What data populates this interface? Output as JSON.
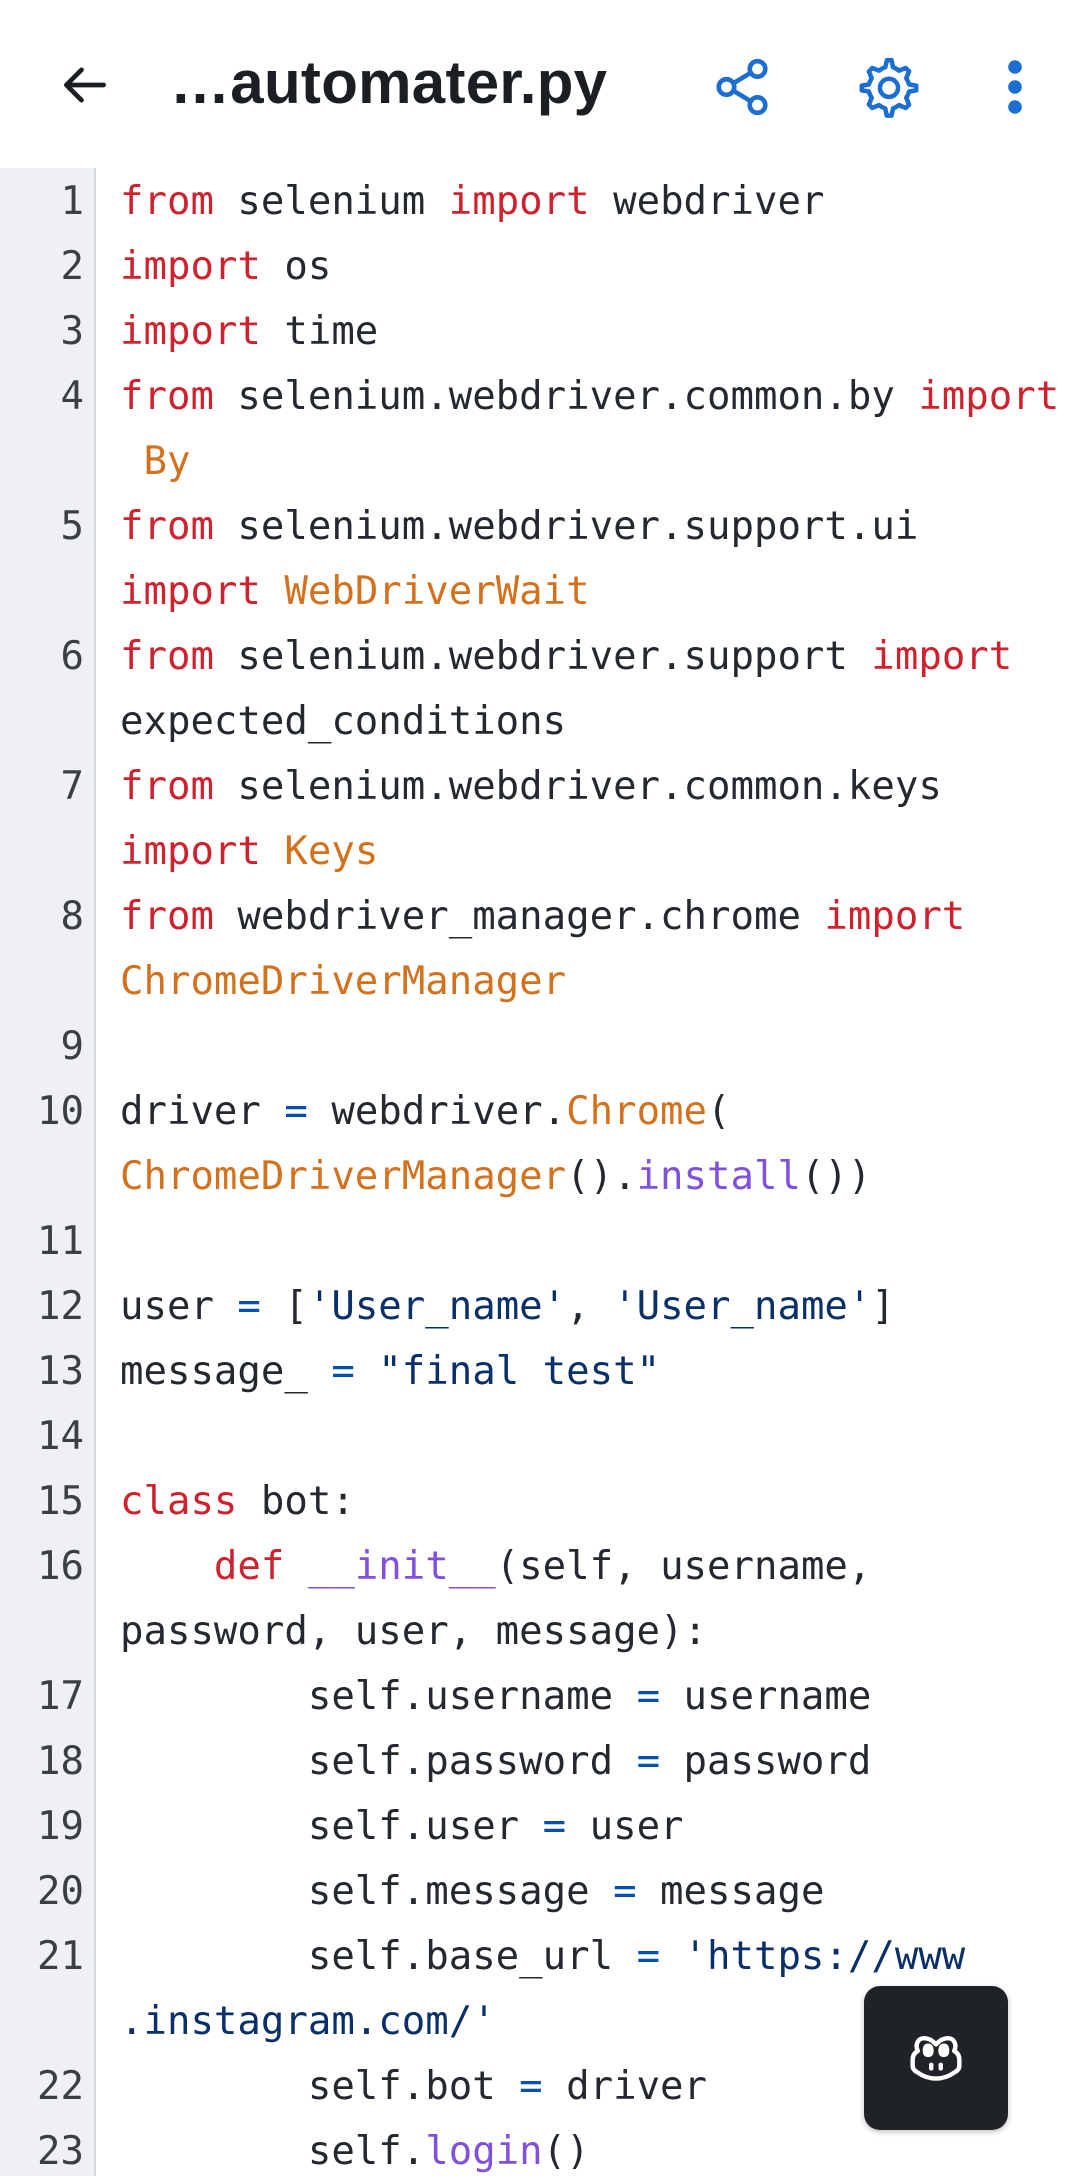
{
  "app": {
    "title": "…automater.py"
  },
  "header": {
    "back_icon": "arrow-left-icon",
    "share_icon": "share-icon",
    "settings_icon": "gear-icon",
    "more_icon": "kebab-menu-icon"
  },
  "colors": {
    "keyword": "#cf222e",
    "class_name": "#d3711c",
    "function": "#8250df",
    "string": "#0a3069",
    "operator": "#0550ae",
    "default": "#24292f",
    "icon_blue": "#1c6fd1"
  },
  "code": {
    "lines": [
      {
        "n": "1",
        "rows": [
          [
            [
              "kw",
              "from"
            ],
            [
              "tx",
              " selenium "
            ],
            [
              "kw",
              "import"
            ],
            [
              "tx",
              " webdriver"
            ]
          ]
        ]
      },
      {
        "n": "2",
        "rows": [
          [
            [
              "kw",
              "import"
            ],
            [
              "tx",
              " os"
            ]
          ]
        ]
      },
      {
        "n": "3",
        "rows": [
          [
            [
              "kw",
              "import"
            ],
            [
              "tx",
              " time"
            ]
          ]
        ]
      },
      {
        "n": "4",
        "rows": [
          [
            [
              "kw",
              "from"
            ],
            [
              "tx",
              " selenium.webdriver.common.by "
            ],
            [
              "kw",
              "import"
            ]
          ],
          [
            [
              "tx",
              " "
            ],
            [
              "cl",
              "By"
            ]
          ]
        ]
      },
      {
        "n": "5",
        "rows": [
          [
            [
              "kw",
              "from"
            ],
            [
              "tx",
              " selenium.webdriver.support.ui"
            ]
          ],
          [
            [
              "kw",
              "import"
            ],
            [
              "tx",
              " "
            ],
            [
              "cl",
              "WebDriverWait"
            ]
          ]
        ]
      },
      {
        "n": "6",
        "rows": [
          [
            [
              "kw",
              "from"
            ],
            [
              "tx",
              " selenium.webdriver.support "
            ],
            [
              "kw",
              "import"
            ]
          ],
          [
            [
              "tx",
              "expected_conditions"
            ]
          ]
        ]
      },
      {
        "n": "7",
        "rows": [
          [
            [
              "kw",
              "from"
            ],
            [
              "tx",
              " selenium.webdriver.common.keys"
            ]
          ],
          [
            [
              "kw",
              "import"
            ],
            [
              "tx",
              " "
            ],
            [
              "cl",
              "Keys"
            ]
          ]
        ]
      },
      {
        "n": "8",
        "rows": [
          [
            [
              "kw",
              "from"
            ],
            [
              "tx",
              " webdriver_manager.chrome "
            ],
            [
              "kw",
              "import"
            ]
          ],
          [
            [
              "cl",
              "ChromeDriverManager"
            ]
          ]
        ]
      },
      {
        "n": "9",
        "rows": [
          [
            [
              "tx",
              ""
            ]
          ]
        ]
      },
      {
        "n": "10",
        "rows": [
          [
            [
              "tx",
              "driver "
            ],
            [
              "op",
              "="
            ],
            [
              "tx",
              " webdriver."
            ],
            [
              "cl",
              "Chrome"
            ],
            [
              "tx",
              "("
            ]
          ],
          [
            [
              "cl",
              "ChromeDriverManager"
            ],
            [
              "tx",
              "()."
            ],
            [
              "fn",
              "install"
            ],
            [
              "tx",
              "())"
            ]
          ]
        ]
      },
      {
        "n": "11",
        "rows": [
          [
            [
              "tx",
              ""
            ]
          ]
        ]
      },
      {
        "n": "12",
        "rows": [
          [
            [
              "tx",
              "user "
            ],
            [
              "op",
              "="
            ],
            [
              "tx",
              " ["
            ],
            [
              "st",
              "'User_name'"
            ],
            [
              "tx",
              ", "
            ],
            [
              "st",
              "'User_name'"
            ],
            [
              "tx",
              "]"
            ]
          ]
        ]
      },
      {
        "n": "13",
        "rows": [
          [
            [
              "tx",
              "message_ "
            ],
            [
              "op",
              "="
            ],
            [
              "tx",
              " "
            ],
            [
              "st",
              "\"final test\""
            ]
          ]
        ]
      },
      {
        "n": "14",
        "rows": [
          [
            [
              "tx",
              ""
            ]
          ]
        ]
      },
      {
        "n": "15",
        "rows": [
          [
            [
              "kw",
              "class"
            ],
            [
              "tx",
              " bot:"
            ]
          ]
        ]
      },
      {
        "n": "16",
        "rows": [
          [
            [
              "tx",
              "    "
            ],
            [
              "kw",
              "def"
            ],
            [
              "tx",
              " "
            ],
            [
              "fn",
              "__init__"
            ],
            [
              "tx",
              "(self, username,"
            ]
          ],
          [
            [
              "tx",
              "password, user, message):"
            ]
          ]
        ]
      },
      {
        "n": "17",
        "rows": [
          [
            [
              "tx",
              "        self.username "
            ],
            [
              "op",
              "="
            ],
            [
              "tx",
              " username"
            ]
          ]
        ]
      },
      {
        "n": "18",
        "rows": [
          [
            [
              "tx",
              "        self.password "
            ],
            [
              "op",
              "="
            ],
            [
              "tx",
              " password"
            ]
          ]
        ]
      },
      {
        "n": "19",
        "rows": [
          [
            [
              "tx",
              "        self.user "
            ],
            [
              "op",
              "="
            ],
            [
              "tx",
              " user"
            ]
          ]
        ]
      },
      {
        "n": "20",
        "rows": [
          [
            [
              "tx",
              "        self.message "
            ],
            [
              "op",
              "="
            ],
            [
              "tx",
              " message"
            ]
          ]
        ]
      },
      {
        "n": "21",
        "rows": [
          [
            [
              "tx",
              "        self.base_url "
            ],
            [
              "op",
              "="
            ],
            [
              "tx",
              " "
            ],
            [
              "st",
              "'https://www"
            ]
          ],
          [
            [
              "st",
              ".instagram.com/'"
            ]
          ]
        ]
      },
      {
        "n": "22",
        "rows": [
          [
            [
              "tx",
              "        self.bot "
            ],
            [
              "op",
              "="
            ],
            [
              "tx",
              " driver"
            ]
          ]
        ]
      },
      {
        "n": "23",
        "rows": [
          [
            [
              "tx",
              "        self."
            ],
            [
              "fn",
              "login"
            ],
            [
              "tx",
              "()"
            ]
          ]
        ]
      }
    ]
  },
  "fab": {
    "icon": "copilot-icon"
  }
}
